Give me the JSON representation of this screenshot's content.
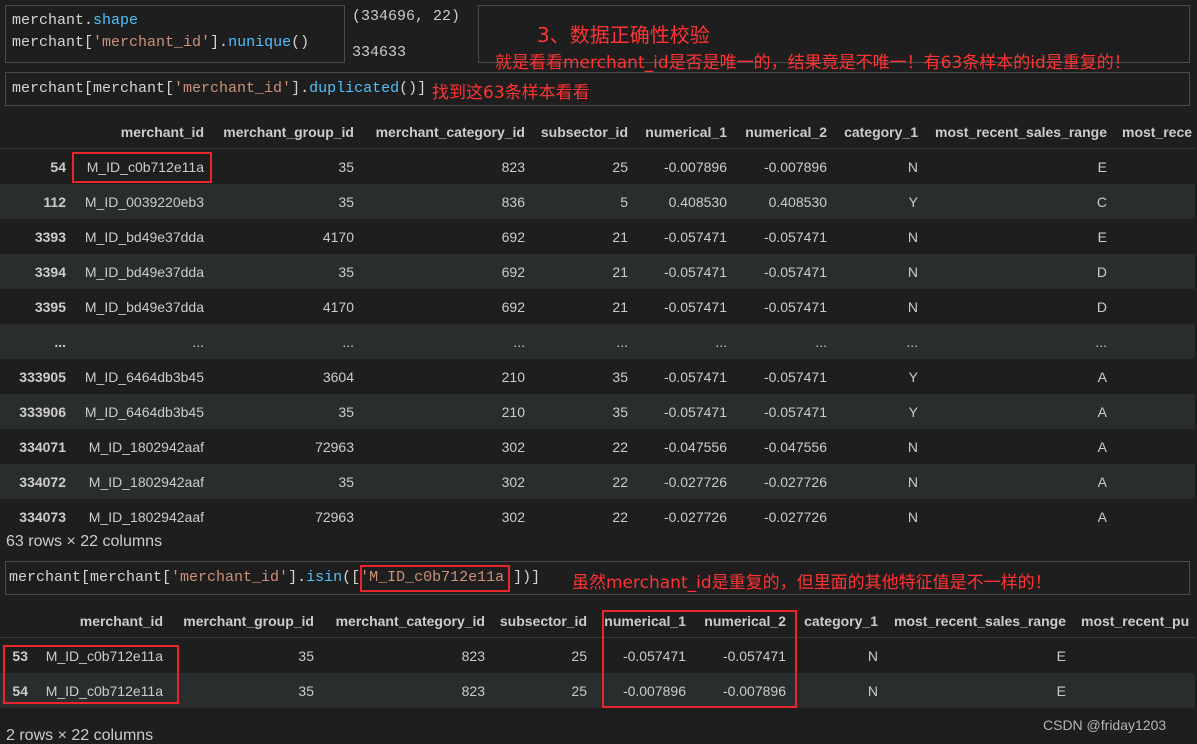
{
  "theme": {
    "background": "#1e1e1e",
    "row_stripe": "#2a2d2e",
    "text": "#cccccc",
    "cell_border": "#4a4a4a",
    "annotation_red": "#ff3333",
    "highlight_red": "#e8262b"
  },
  "cells": {
    "shape_cell": {
      "code": [
        [
          {
            "text": "merchant.",
            "color": "#d4d4d4"
          },
          {
            "text": "shape",
            "color": "#4fc1ff"
          }
        ],
        [
          {
            "text": "merchant[",
            "color": "#d4d4d4"
          },
          {
            "text": "'merchant_id'",
            "color": "#ce9178"
          },
          {
            "text": "].",
            "color": "#d4d4d4"
          },
          {
            "text": "nunique",
            "color": "#4fc1ff"
          },
          {
            "text": "()",
            "color": "#d4d4d4"
          }
        ]
      ],
      "outputs": [
        "(334696, 22)",
        "334633"
      ]
    },
    "duplicated_cell": {
      "code": [
        [
          {
            "text": "merchant[merchant[",
            "color": "#d4d4d4"
          },
          {
            "text": "'merchant_id'",
            "color": "#ce9178"
          },
          {
            "text": "].",
            "color": "#d4d4d4"
          },
          {
            "text": "duplicated",
            "color": "#4fc1ff"
          },
          {
            "text": "()]",
            "color": "#d4d4d4"
          }
        ]
      ]
    },
    "isin_cell": {
      "code": [
        [
          {
            "text": "merchant[merchant[",
            "color": "#d4d4d4"
          },
          {
            "text": "'merchant_id'",
            "color": "#ce9178"
          },
          {
            "text": "].",
            "color": "#d4d4d4"
          },
          {
            "text": "isin",
            "color": "#4fc1ff"
          },
          {
            "text": "([",
            "color": "#d4d4d4"
          },
          {
            "text": "'M_ID_c0b712e11a'",
            "color": "#ce9178"
          },
          {
            "text": "])]",
            "color": "#d4d4d4"
          }
        ]
      ]
    }
  },
  "annotations": {
    "section_title": "3、数据正确性校验",
    "uniqueness_note": "就是看看merchant_id是否是唯一的，结果竟是不唯一！有63条样本的id是重复的！",
    "find_note": "找到这63条样本看看",
    "difference_note": "虽然merchant_id是重复的，但里面的其他特征值是不一样的！"
  },
  "tables": {
    "duplicates": {
      "columns": [
        "merchant_id",
        "merchant_group_id",
        "merchant_category_id",
        "subsector_id",
        "numerical_1",
        "numerical_2",
        "category_1",
        "most_recent_sales_range",
        "most_rece"
      ],
      "rows": [
        {
          "index": "54",
          "values": [
            "M_ID_c0b712e11a",
            "35",
            "823",
            "25",
            "-0.007896",
            "-0.007896",
            "N",
            "E"
          ]
        },
        {
          "index": "112",
          "values": [
            "M_ID_0039220eb3",
            "35",
            "836",
            "5",
            "0.408530",
            "0.408530",
            "Y",
            "C"
          ]
        },
        {
          "index": "3393",
          "values": [
            "M_ID_bd49e37dda",
            "4170",
            "692",
            "21",
            "-0.057471",
            "-0.057471",
            "N",
            "E"
          ]
        },
        {
          "index": "3394",
          "values": [
            "M_ID_bd49e37dda",
            "35",
            "692",
            "21",
            "-0.057471",
            "-0.057471",
            "N",
            "D"
          ]
        },
        {
          "index": "3395",
          "values": [
            "M_ID_bd49e37dda",
            "4170",
            "692",
            "21",
            "-0.057471",
            "-0.057471",
            "N",
            "D"
          ]
        },
        {
          "index": "...",
          "values": [
            "...",
            "...",
            "...",
            "...",
            "...",
            "...",
            "...",
            "..."
          ]
        },
        {
          "index": "333905",
          "values": [
            "M_ID_6464db3b45",
            "3604",
            "210",
            "35",
            "-0.057471",
            "-0.057471",
            "Y",
            "A"
          ]
        },
        {
          "index": "333906",
          "values": [
            "M_ID_6464db3b45",
            "35",
            "210",
            "35",
            "-0.057471",
            "-0.057471",
            "Y",
            "A"
          ]
        },
        {
          "index": "334071",
          "values": [
            "M_ID_1802942aaf",
            "72963",
            "302",
            "22",
            "-0.047556",
            "-0.047556",
            "N",
            "A"
          ]
        },
        {
          "index": "334072",
          "values": [
            "M_ID_1802942aaf",
            "35",
            "302",
            "22",
            "-0.027726",
            "-0.027726",
            "N",
            "A"
          ]
        },
        {
          "index": "334073",
          "values": [
            "M_ID_1802942aaf",
            "72963",
            "302",
            "22",
            "-0.027726",
            "-0.027726",
            "N",
            "A"
          ]
        }
      ],
      "shape_note": "63 rows × 22 columns"
    },
    "selected": {
      "columns": [
        "merchant_id",
        "merchant_group_id",
        "merchant_category_id",
        "subsector_id",
        "numerical_1",
        "numerical_2",
        "category_1",
        "most_recent_sales_range",
        "most_recent_pu"
      ],
      "rows": [
        {
          "index": "53",
          "values": [
            "M_ID_c0b712e11a",
            "35",
            "823",
            "25",
            "-0.057471",
            "-0.057471",
            "N",
            "E"
          ]
        },
        {
          "index": "54",
          "values": [
            "M_ID_c0b712e11a",
            "35",
            "823",
            "25",
            "-0.007896",
            "-0.007896",
            "N",
            "E"
          ]
        }
      ],
      "shape_note": "2 rows × 22 columns"
    }
  },
  "watermark": "CSDN @friday1203"
}
